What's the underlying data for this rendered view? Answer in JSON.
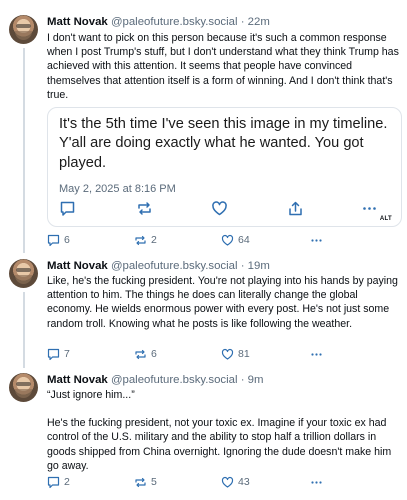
{
  "posts": [
    {
      "author": "Matt Novak",
      "handle": "@paleofuture.bsky.social",
      "time": "· 22m",
      "paragraphs": [
        "I don't want to pick on this person because it's such a common response when I post Trump's stuff, but I don't understand what they think Trump has achieved with this attention. It seems that people have convinced themselves that attention itself is a form of winning. And I don't think that's true."
      ],
      "embed": {
        "quote": "It's the 5th time I've seen this image in my timeline. Y'all are doing exactly what he wanted. You got played.",
        "date": "May 2, 2025 at 8:16 PM",
        "alt_badge": "ALT"
      },
      "replies": "6",
      "reposts": "2",
      "likes": "64"
    },
    {
      "author": "Matt Novak",
      "handle": "@paleofuture.bsky.social",
      "time": "· 19m",
      "paragraphs": [
        "Like, he's the fucking president. You're not playing into his hands by paying attention to him. The things he does can literally change the global economy. He wields enormous power with every post. He's not just some random troll. Knowing what he posts is like following the weather."
      ],
      "replies": "7",
      "reposts": "6",
      "likes": "81"
    },
    {
      "author": "Matt Novak",
      "handle": "@paleofuture.bsky.social",
      "time": "· 9m",
      "paragraphs": [
        "“Just ignore him...”",
        "He's the fucking president, not your toxic ex. Imagine if your toxic ex had control of the U.S. military and the ability to stop half a trillion dollars in goods shipped from China overnight. Ignoring the dude doesn't make him go away."
      ],
      "replies": "2",
      "reposts": "5",
      "likes": "43"
    }
  ],
  "icons": {
    "reply": "speech-bubble-icon",
    "repost": "repost-arrows-icon",
    "like": "heart-icon",
    "more": "ellipsis-icon",
    "share": "share-icon"
  },
  "colors": {
    "text": "#0b0f14",
    "muted": "#5b6b7b",
    "border": "#dfe4ea"
  }
}
